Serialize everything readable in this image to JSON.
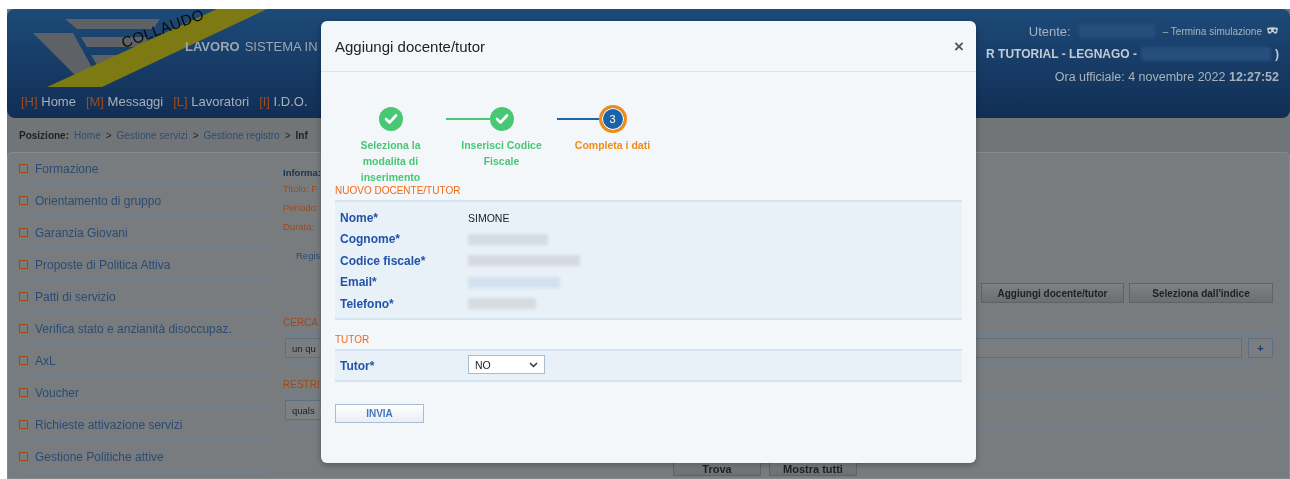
{
  "header": {
    "ribbon": "COLLAUDO",
    "brand_bold": "LAVORO",
    "brand_rest": "SISTEMA IN",
    "nav": [
      {
        "key": "[H]",
        "label": "Home"
      },
      {
        "key": "[M]",
        "label": "Messaggi"
      },
      {
        "key": "[L]",
        "label": "Lavoratori"
      },
      {
        "key": "[I]",
        "label": "I.D.O."
      }
    ],
    "user_label": "Utente:",
    "end_simulation": "– Termina simulazione",
    "office": "R TUTORIAL - LEGNAGO -",
    "office_end": ")",
    "clock_label": "Ora ufficiale: 4 novembre 2022",
    "clock_time": "12:27:52"
  },
  "breadcrumb": {
    "label": "Posizione:",
    "separator": ">",
    "items": [
      "Home",
      "Gestione servizi",
      "Gestione registro",
      "Inf"
    ]
  },
  "sidebar": {
    "items": [
      "Formazione",
      "Orientamento di gruppo",
      "Garanzia Giovani",
      "Proposte di Politica Attiva",
      "Patti di servizio",
      "Verifica stato e anzianità disoccupaz.",
      "AxL",
      "Voucher",
      "Richieste attivazione servizi",
      "Gestione Politiche attive"
    ]
  },
  "info": {
    "heading": "Informa:",
    "lines": [
      "Titolo: F",
      "Periodo:",
      "Durata:"
    ],
    "link": "Regis"
  },
  "actions": [
    "Aggiungi docente/tutor",
    "Seleziona dall'indice"
  ],
  "search": {
    "heading": "CERCA",
    "value": "un qu",
    "add": "+"
  },
  "restrict": {
    "heading": "RESTRI",
    "value": "quals"
  },
  "bottom_buttons": [
    "Trova",
    "Mostra tutti"
  ],
  "modal": {
    "title": "Aggiungi docente/tutor",
    "close": "×",
    "steps": [
      {
        "label": "Seleziona la modalita di inserimento",
        "completed": true,
        "selected": false
      },
      {
        "label": "Inserisci Codice Fiscale",
        "completed": true,
        "selected": false
      },
      {
        "label": "Completa i dati",
        "completed": false,
        "selected": true,
        "number": "3"
      }
    ],
    "sections": [
      {
        "title": "NUOVO DOCENTE/TUTOR",
        "fields": [
          {
            "label": "Nome*",
            "kind": "text",
            "value": "SIMONE"
          },
          {
            "label": "Cognome*",
            "kind": "redacted"
          },
          {
            "label": "Codice fiscale*",
            "kind": "redacted"
          },
          {
            "label": "Email*",
            "kind": "redacted"
          },
          {
            "label": "Telefono*",
            "kind": "redacted"
          }
        ]
      },
      {
        "title": "TUTOR",
        "fields": [
          {
            "label": "Tutor*",
            "kind": "select",
            "value": "NO"
          }
        ]
      }
    ],
    "submit": "INVIA"
  }
}
